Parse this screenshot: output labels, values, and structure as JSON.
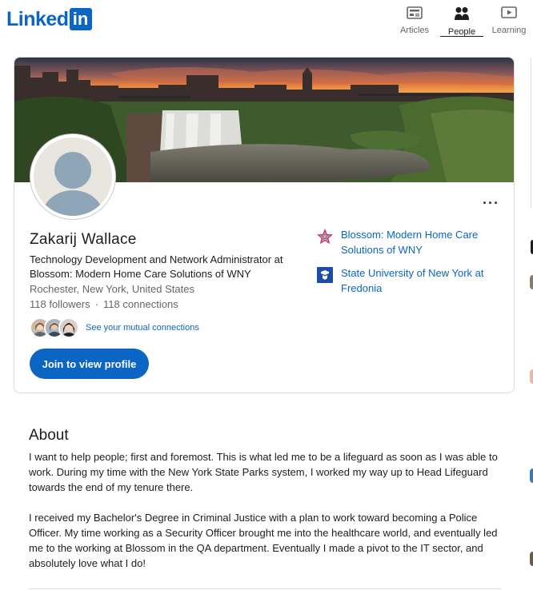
{
  "header": {
    "logo": {
      "text": "Linked",
      "box": "in"
    },
    "nav": [
      {
        "label": "Articles",
        "icon": "articles-icon"
      },
      {
        "label": "People",
        "icon": "people-icon",
        "active": true
      },
      {
        "label": "Learning",
        "icon": "learning-icon"
      }
    ]
  },
  "profile": {
    "name": "Zakarij Wallace",
    "headline": "Technology Development and Network Administrator at Blossom: Modern Home Care Solutions of WNY",
    "location": "Rochester, New York, United States",
    "followers": "118 followers",
    "connections": "118 connections",
    "dot": "·",
    "mutual_link": "See your mutual connections",
    "join_button": "Join to view profile",
    "more_button": "···",
    "organizations": [
      {
        "name": "Blossom: Modern Home Care Solutions of WNY",
        "icon": "blossom-logo-icon"
      },
      {
        "name": "State University of New York at Fredonia",
        "icon": "university-logo-icon"
      }
    ]
  },
  "about": {
    "title": "About",
    "paragraphs": [
      "I want to help people; first and foremost. This is what led me to be a lifeguard as soon as I was able to work. During my time with the New York State Parks system, I worked my way up to Head Lifeguard towards the end of my tenure there.",
      "I received my Bachelor's Degree in Criminal Justice with a plan to work toward becoming a Police Officer. My time working as a Security Officer brought me into the healthcare world, and eventually led me to the working at Blossom in the QA department. Eventually I made a pivot to the IT sector, and absolutely love what I do!"
    ]
  },
  "colors": {
    "brand": "#0a66c2",
    "text": "#1d1d1d",
    "muted": "#666666"
  }
}
